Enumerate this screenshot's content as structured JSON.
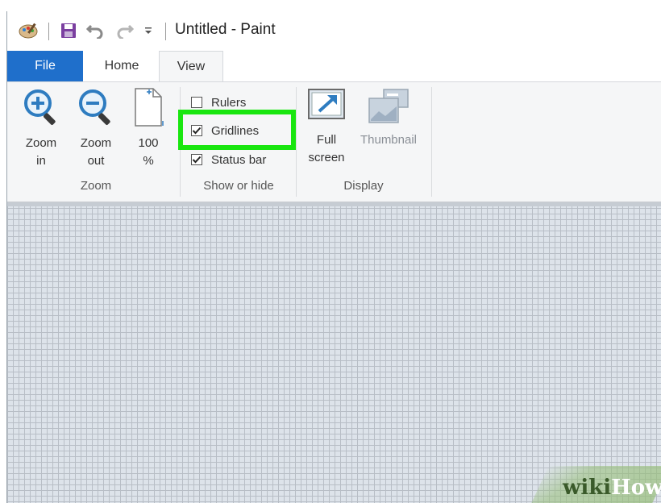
{
  "window": {
    "title": "Untitled - Paint"
  },
  "quick_access": {
    "icons": [
      "paint-app-icon",
      "save-icon",
      "undo-icon",
      "redo-icon",
      "customize-dropdown-icon"
    ]
  },
  "tabs": [
    {
      "label": "File",
      "state": "file"
    },
    {
      "label": "Home",
      "state": "normal"
    },
    {
      "label": "View",
      "state": "active"
    }
  ],
  "ribbon": {
    "zoom": {
      "group_label": "Zoom",
      "zoom_in": {
        "line1": "Zoom",
        "line2": "in"
      },
      "zoom_out": {
        "line1": "Zoom",
        "line2": "out"
      },
      "hundred": {
        "line1": "100",
        "line2": "%"
      }
    },
    "show_or_hide": {
      "group_label": "Show or hide",
      "items": [
        {
          "label": "Rulers",
          "checked": false
        },
        {
          "label": "Gridlines",
          "checked": true
        },
        {
          "label": "Status bar",
          "checked": true
        }
      ]
    },
    "display": {
      "group_label": "Display",
      "full_screen": {
        "line1": "Full",
        "line2": "screen"
      },
      "thumbnail": {
        "label": "Thumbnail",
        "enabled": false
      }
    }
  },
  "watermark": {
    "wiki": "wiki",
    "how": "How"
  },
  "colors": {
    "file_tab": "#1f6fcb",
    "highlight": "#19e60f",
    "ribbon_bg": "#f5f6f7",
    "canvas_grid": "#b8bec6"
  }
}
